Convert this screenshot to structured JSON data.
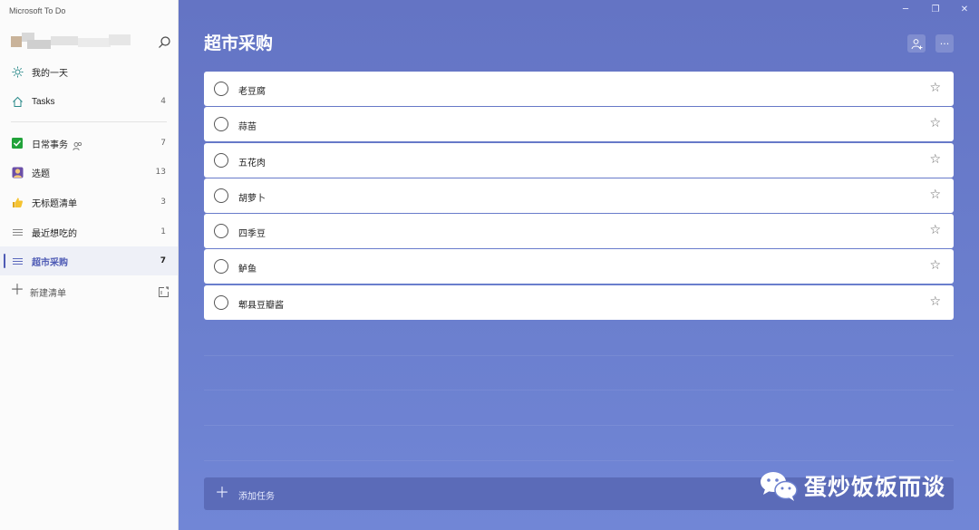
{
  "app": {
    "title": "Microsoft To Do"
  },
  "sidebar": {
    "items": [
      {
        "label": "我的一天",
        "count": "",
        "icon": "sun-icon"
      },
      {
        "label": "Tasks",
        "count": "4",
        "icon": "home-icon"
      },
      {
        "label": "日常事务",
        "count": "7",
        "icon": "check-box-icon"
      },
      {
        "label": "选题",
        "count": "13",
        "icon": "person-emoji-icon"
      },
      {
        "label": "无标题清单",
        "count": "3",
        "icon": "thumbs-up-icon"
      },
      {
        "label": "最近想吃的",
        "count": "1",
        "icon": "list-lines-icon"
      },
      {
        "label": "超市采购",
        "count": "7",
        "icon": "list-lines-icon"
      }
    ],
    "new_list_label": "新建清单"
  },
  "window_controls": {
    "minimize": "─",
    "restore": "❐",
    "close": "✕"
  },
  "main": {
    "list_title": "超市采购",
    "more_label": "···",
    "tasks": [
      {
        "title": "老豆腐"
      },
      {
        "title": "蒜苗"
      },
      {
        "title": "五花肉"
      },
      {
        "title": "胡萝卜"
      },
      {
        "title": "四季豆"
      },
      {
        "title": "鲈鱼"
      },
      {
        "title": "郫县豆瓣酱"
      }
    ],
    "add_task_label": "添加任务"
  },
  "watermark": {
    "text": "蛋炒饭饭而谈"
  },
  "colors": {
    "accent": "#4e5bb5",
    "main_bg": "#6474c4",
    "add_task_bg": "#5b6bb8"
  }
}
